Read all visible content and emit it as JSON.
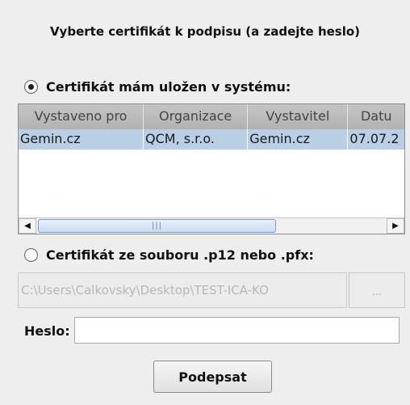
{
  "title": "Vyberte certifikát k podpisu (a zadejte heslo)",
  "option_system": {
    "label": "Certifikát mám uložen v systému:",
    "selected": true
  },
  "table": {
    "columns": [
      "Vystaveno pro",
      "Organizace",
      "Vystavitel",
      "Datu"
    ],
    "rows": [
      [
        "Gemin.cz",
        "QCM, s.r.o.",
        "Gemin.cz",
        "07.07.2"
      ]
    ]
  },
  "scrollbar": {
    "left_arrow": "◀",
    "right_arrow": "▶",
    "grip": "|||"
  },
  "option_file": {
    "label": "Certifikát ze souboru .p12 nebo .pfx:",
    "selected": false
  },
  "file_path": "C:\\Users\\Calkovsky\\Desktop\\TEST-ICA-KO",
  "browse_label": "...",
  "password": {
    "label": "Heslo:",
    "value": ""
  },
  "sign_button": "Podepsat"
}
